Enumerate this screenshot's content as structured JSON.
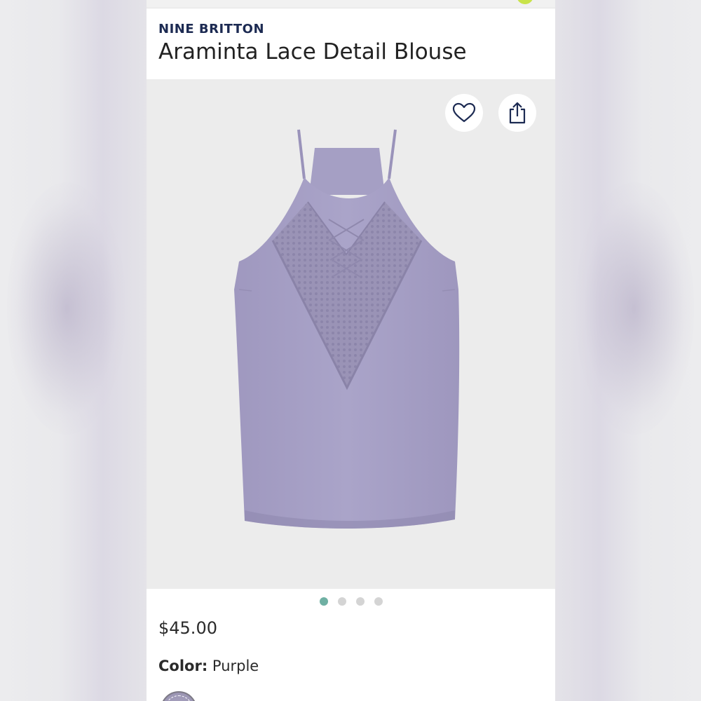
{
  "product": {
    "brand": "NINE BRITTON",
    "title": "Araminta Lace Detail Blouse",
    "price": "$45.00",
    "color_label": "Color:",
    "color_value": "Purple"
  },
  "gallery": {
    "image_count": 4,
    "active_index": 0
  },
  "icons": {
    "favorite": "heart-icon",
    "share": "share-icon"
  },
  "colors": {
    "brand_text": "#1c2a52",
    "active_dot": "#6fb0a3",
    "inactive_dot": "#d4d4d4",
    "blouse": "#a9a3c8",
    "notification": "#c9e34a"
  }
}
